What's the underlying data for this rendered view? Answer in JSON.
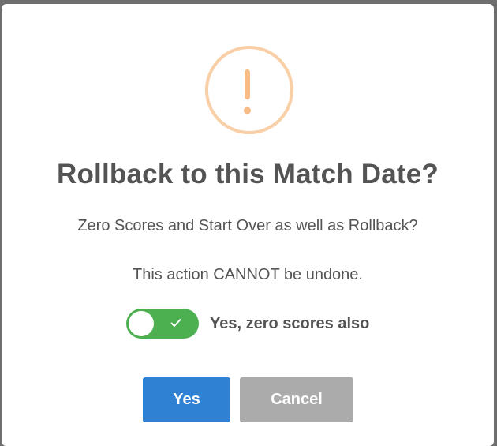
{
  "dialog": {
    "icon": "warning-exclamation-icon",
    "icon_color": "#f8bb86",
    "title": "Rollback to this Match Date?",
    "message_1": "Zero Scores and Start Over as well as Rollback?",
    "message_2": "This action CANNOT be undone.",
    "toggle": {
      "label": "Yes, zero scores also",
      "checked": true,
      "on_color": "#4caf50"
    },
    "buttons": {
      "confirm_label": "Yes",
      "confirm_color": "#2f82d3",
      "cancel_label": "Cancel",
      "cancel_color": "#ababab"
    }
  }
}
